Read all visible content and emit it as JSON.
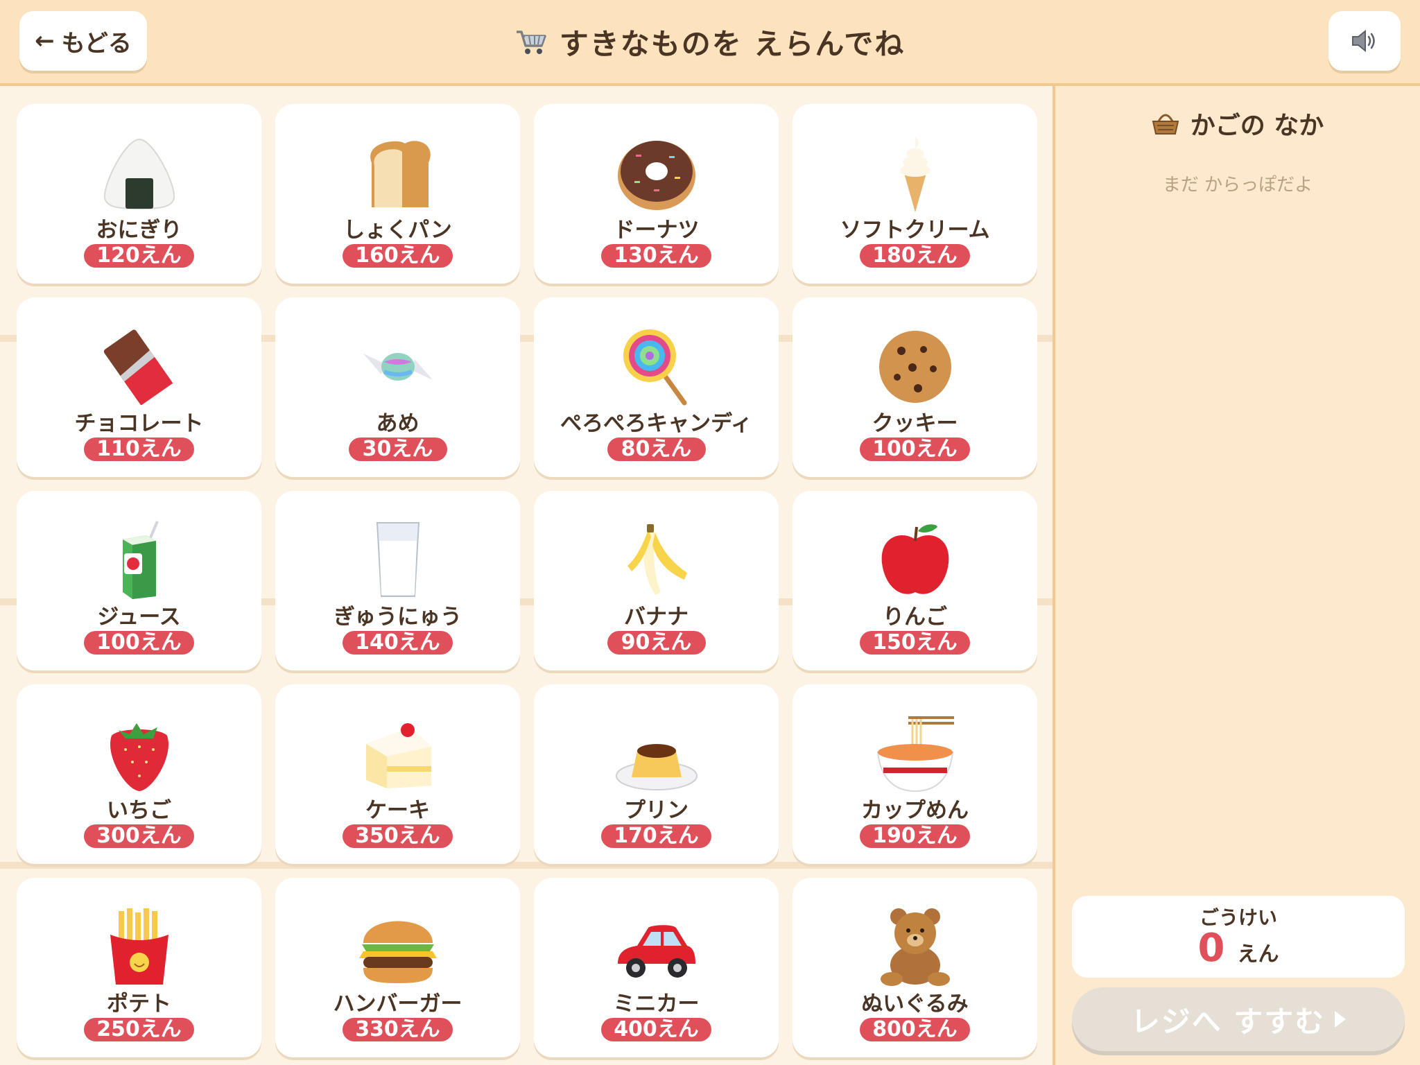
{
  "header": {
    "back_arrow": "←",
    "back_label": "もどる",
    "title": "すきなものを えらんでね",
    "cart_icon": "shopping-cart-icon",
    "sound_icon": "speaker-icon"
  },
  "colors": {
    "header_bg": "#fde3bd",
    "page_bg": "#fdf3e4",
    "price_badge": "#e0505a",
    "panel_bg": "#fde9cd",
    "checkout_disabled": "#e6dfd6"
  },
  "products": [
    {
      "name": "おにぎり",
      "price": "120えん",
      "icon": "rice-ball-icon"
    },
    {
      "name": "しょくパン",
      "price": "160えん",
      "icon": "bread-icon"
    },
    {
      "name": "ドーナツ",
      "price": "130えん",
      "icon": "donut-icon"
    },
    {
      "name": "ソフトクリーム",
      "price": "180えん",
      "icon": "soft-ice-cream-icon"
    },
    {
      "name": "チョコレート",
      "price": "110えん",
      "icon": "chocolate-bar-icon"
    },
    {
      "name": "あめ",
      "price": "30えん",
      "icon": "candy-icon"
    },
    {
      "name": "ぺろぺろキャンディ",
      "price": "80えん",
      "icon": "lollipop-icon"
    },
    {
      "name": "クッキー",
      "price": "100えん",
      "icon": "cookie-icon"
    },
    {
      "name": "ジュース",
      "price": "100えん",
      "icon": "juice-box-icon"
    },
    {
      "name": "ぎゅうにゅう",
      "price": "140えん",
      "icon": "milk-glass-icon"
    },
    {
      "name": "バナナ",
      "price": "90えん",
      "icon": "banana-icon"
    },
    {
      "name": "りんご",
      "price": "150えん",
      "icon": "apple-icon"
    },
    {
      "name": "いちご",
      "price": "300えん",
      "icon": "strawberry-icon"
    },
    {
      "name": "ケーキ",
      "price": "350えん",
      "icon": "cake-icon"
    },
    {
      "name": "プリン",
      "price": "170えん",
      "icon": "pudding-icon"
    },
    {
      "name": "カップめん",
      "price": "190えん",
      "icon": "noodle-bowl-icon"
    },
    {
      "name": "ポテト",
      "price": "250えん",
      "icon": "french-fries-icon"
    },
    {
      "name": "ハンバーガー",
      "price": "330えん",
      "icon": "hamburger-icon"
    },
    {
      "name": "ミニカー",
      "price": "400えん",
      "icon": "toy-car-icon"
    },
    {
      "name": "ぬいぐるみ",
      "price": "800えん",
      "icon": "teddy-bear-icon"
    }
  ],
  "basket": {
    "icon": "basket-icon",
    "title": "かごの なか",
    "empty_text": "まだ からっぽだよ",
    "total_label": "ごうけい",
    "total_value": "0",
    "total_unit": "えん",
    "checkout_label": "レジへ すすむ"
  }
}
